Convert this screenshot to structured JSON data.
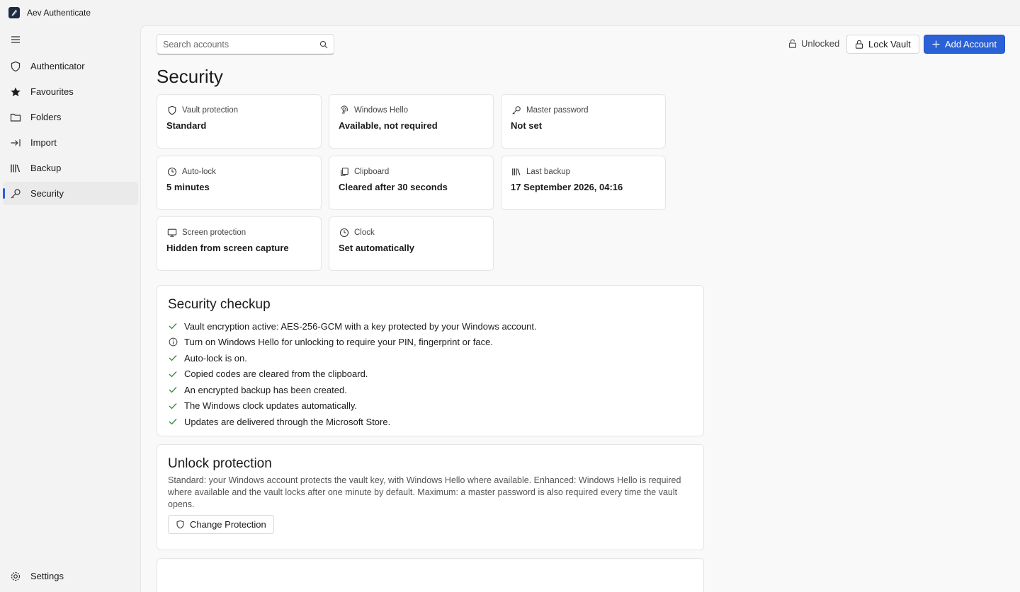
{
  "app": {
    "title": "Aev Authenticate"
  },
  "nav": {
    "items": [
      {
        "label": "Authenticator",
        "icon": "shield-icon"
      },
      {
        "label": "Favourites",
        "icon": "star-icon"
      },
      {
        "label": "Folders",
        "icon": "folder-icon"
      },
      {
        "label": "Import",
        "icon": "import-icon"
      },
      {
        "label": "Backup",
        "icon": "library-icon"
      },
      {
        "label": "Security",
        "icon": "key-icon",
        "active": true
      }
    ],
    "settings_label": "Settings"
  },
  "toolbar": {
    "search_placeholder": "Search accounts",
    "status": "Unlocked",
    "lock_label": "Lock Vault",
    "add_label": "Add Account"
  },
  "page": {
    "title": "Security"
  },
  "cards": [
    {
      "label": "Vault protection",
      "value": "Standard",
      "icon": "shield-icon"
    },
    {
      "label": "Windows Hello",
      "value": "Available, not required",
      "icon": "fingerprint-icon"
    },
    {
      "label": "Master password",
      "value": "Not set",
      "icon": "key-icon"
    },
    {
      "label": "Auto-lock",
      "value": "5 minutes",
      "icon": "clock-icon"
    },
    {
      "label": "Clipboard",
      "value": "Cleared after 30 seconds",
      "icon": "copy-icon"
    },
    {
      "label": "Last backup",
      "value": "17 September 2026, 04:16",
      "icon": "library-icon"
    },
    {
      "label": "Screen protection",
      "value": "Hidden from screen capture",
      "icon": "monitor-icon"
    },
    {
      "label": "Clock",
      "value": "Set automatically",
      "icon": "clock-icon"
    }
  ],
  "checkup": {
    "title": "Security checkup",
    "items": [
      {
        "text": "Vault encryption active: AES-256-GCM with a key protected by your Windows account.",
        "status": "ok"
      },
      {
        "text": "Turn on Windows Hello for unlocking to require your PIN, fingerprint or face.",
        "status": "info"
      },
      {
        "text": "Auto-lock is on.",
        "status": "ok"
      },
      {
        "text": "Copied codes are cleared from the clipboard.",
        "status": "ok"
      },
      {
        "text": "An encrypted backup has been created.",
        "status": "ok"
      },
      {
        "text": "The Windows clock updates automatically.",
        "status": "ok"
      },
      {
        "text": "Updates are delivered through the Microsoft Store.",
        "status": "ok"
      }
    ]
  },
  "unlock": {
    "title": "Unlock protection",
    "description": "Standard: your Windows account protects the vault key, with Windows Hello where available. Enhanced: Windows Hello is required where available and the vault locks after one minute by default. Maximum: a master password is also required every time the vault opens.",
    "button_label": "Change Protection"
  },
  "colors": {
    "accent": "#2a61d6",
    "ok": "#2e8b3e"
  }
}
